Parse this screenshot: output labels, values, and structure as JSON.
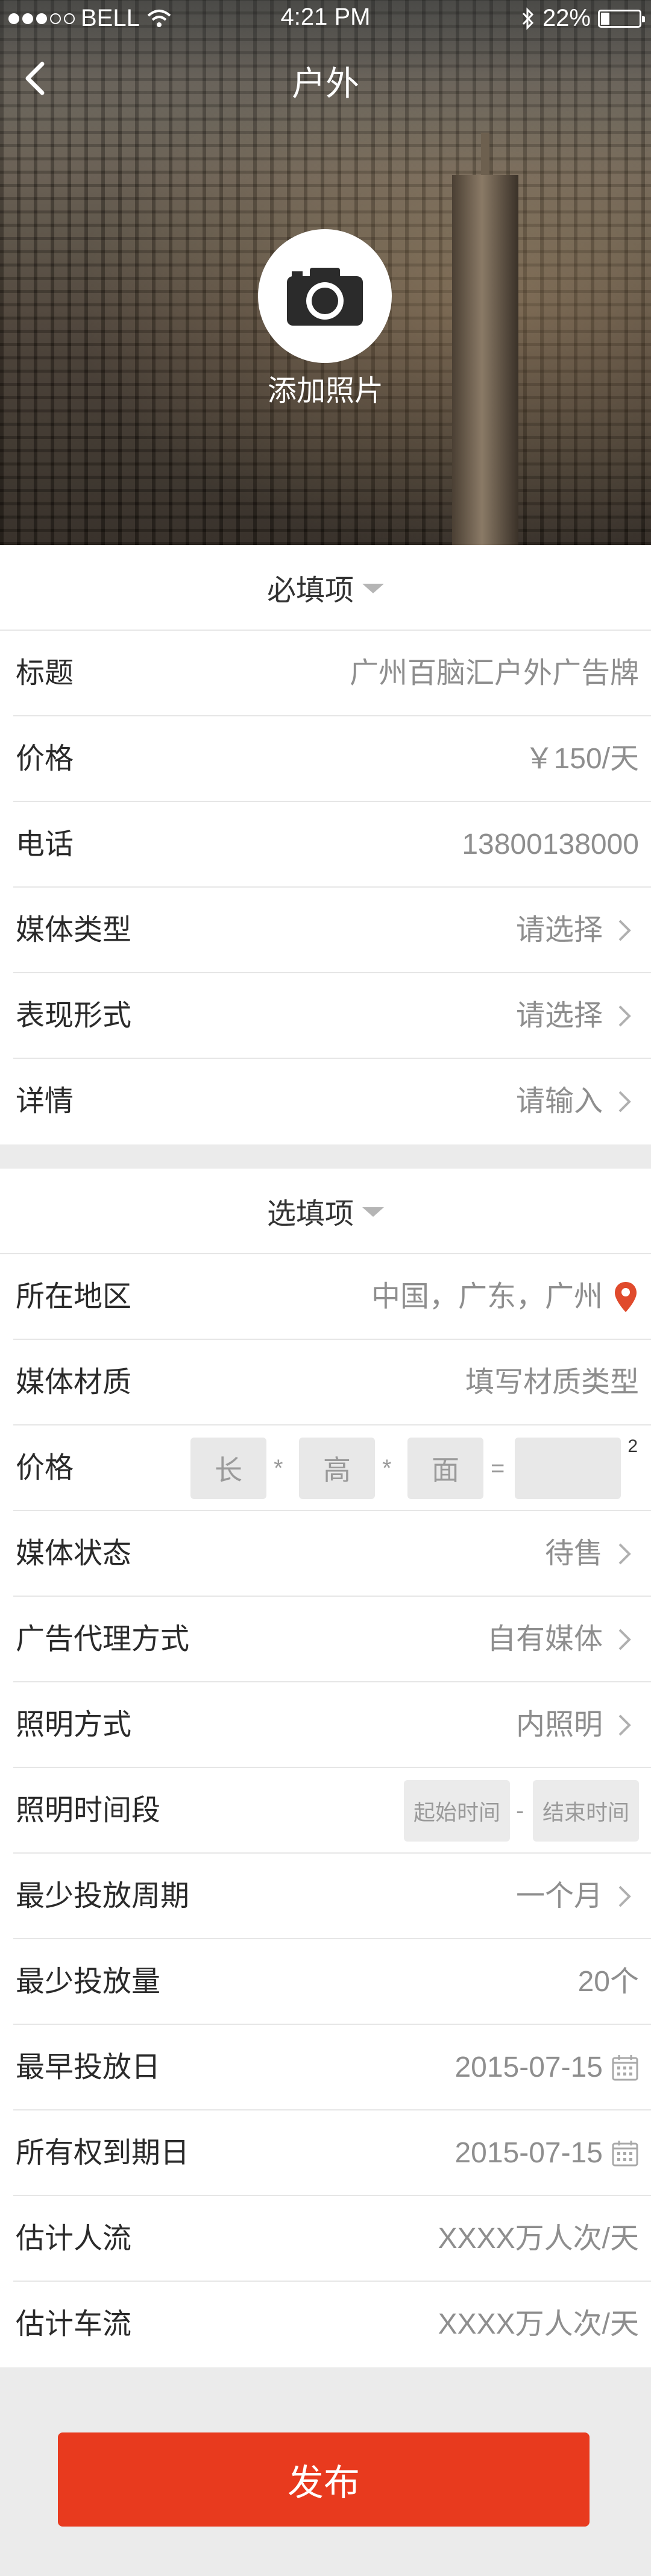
{
  "status_bar": {
    "carrier": "BELL",
    "time": "4:21 PM",
    "battery": "22%"
  },
  "nav": {
    "title": "户外"
  },
  "hero": {
    "add_photo_label": "添加照片"
  },
  "required_section": {
    "title": "必填项",
    "rows": [
      {
        "label": "标题",
        "value": "广州百脑汇户外广告牌"
      },
      {
        "label": "价格",
        "value": "￥150/天"
      },
      {
        "label": "电话",
        "value": "13800138000"
      },
      {
        "label": "媒体类型",
        "value": "请选择"
      },
      {
        "label": "表现形式",
        "value": "请选择"
      },
      {
        "label": "详情",
        "value": "请输入"
      }
    ]
  },
  "optional_section": {
    "title": "选填项",
    "region": {
      "label": "所在地区",
      "value": "中国，广东，广州"
    },
    "material": {
      "label": "媒体材质",
      "value": "填写材质类型"
    },
    "size": {
      "label": "价格",
      "length": "长",
      "height": "高",
      "face": "面",
      "times": "*",
      "equals": "=",
      "unit_sup": "2"
    },
    "media_status": {
      "label": "媒体状态",
      "value": "待售"
    },
    "agency": {
      "label": "广告代理方式",
      "value": "自有媒体"
    },
    "lighting": {
      "label": "照明方式",
      "value": "内照明"
    },
    "lighting_period": {
      "label": "照明时间段",
      "start": "起始时间",
      "dash": "-",
      "end": "结束时间"
    },
    "min_cycle": {
      "label": "最少投放周期",
      "value": "一个月"
    },
    "min_quantity": {
      "label": "最少投放量",
      "value": "20个"
    },
    "earliest_date": {
      "label": "最早投放日",
      "value": "2015-07-15"
    },
    "ownership_date": {
      "label": "所有权到期日",
      "value": "2015-07-15"
    },
    "foot_traffic": {
      "label": "估计人流",
      "value": "XXXX万人次/天"
    },
    "vehicle_traffic": {
      "label": "估计车流",
      "value": "XXXX万人次/天"
    }
  },
  "footer": {
    "publish_label": "发布"
  },
  "colors": {
    "accent": "#e83a1e",
    "pin": "#e04a2c",
    "divider": "#e6e6e6",
    "muted": "#8e8e8e"
  }
}
